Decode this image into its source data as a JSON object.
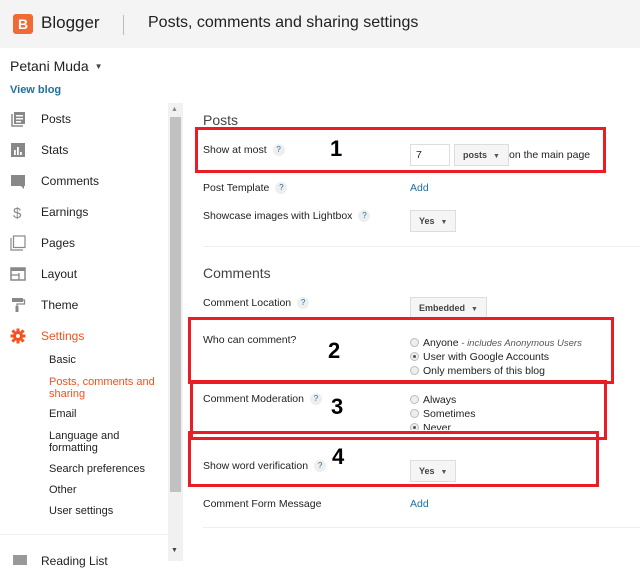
{
  "header": {
    "logo_letter": "B",
    "brand": "Blogger",
    "page_title": "Posts, comments and sharing settings"
  },
  "blog": {
    "name": "Petani Muda",
    "view_blog": "View blog"
  },
  "sidebar": {
    "items": [
      {
        "label": "Posts",
        "icon": "posts-icon"
      },
      {
        "label": "Stats",
        "icon": "stats-icon"
      },
      {
        "label": "Comments",
        "icon": "comments-icon"
      },
      {
        "label": "Earnings",
        "icon": "dollar-icon"
      },
      {
        "label": "Pages",
        "icon": "pages-icon"
      },
      {
        "label": "Layout",
        "icon": "layout-icon"
      },
      {
        "label": "Theme",
        "icon": "paint-roller-icon"
      },
      {
        "label": "Settings",
        "icon": "gear-icon",
        "active": true
      }
    ],
    "settings_sub": [
      {
        "label": "Basic"
      },
      {
        "label": "Posts, comments and sharing",
        "active": true
      },
      {
        "label": "Email"
      },
      {
        "label": "Language and formatting"
      },
      {
        "label": "Search preferences"
      },
      {
        "label": "Other"
      },
      {
        "label": "User settings"
      }
    ],
    "reading_list": "Reading List"
  },
  "accent_color": "#f4511e",
  "annotation_color": "#ec1c24",
  "posts_section": {
    "title": "Posts",
    "show_at_most": {
      "label": "Show at most",
      "value": "7",
      "unit": "posts",
      "suffix": "on the main page"
    },
    "post_template": {
      "label": "Post Template",
      "action": "Add"
    },
    "lightbox": {
      "label": "Showcase images with Lightbox",
      "value": "Yes"
    }
  },
  "comments_section": {
    "title": "Comments",
    "location": {
      "label": "Comment Location",
      "value": "Embedded"
    },
    "who_can_comment": {
      "label": "Who can comment?",
      "options": [
        {
          "label": "Anyone",
          "note": " - includes Anonymous Users",
          "checked": false
        },
        {
          "label": "User with Google Accounts",
          "note": "",
          "checked": true
        },
        {
          "label": "Only members of this blog",
          "note": "",
          "checked": false
        }
      ]
    },
    "moderation": {
      "label": "Comment Moderation",
      "options": [
        {
          "label": "Always",
          "checked": false
        },
        {
          "label": "Sometimes",
          "checked": false
        },
        {
          "label": "Never",
          "checked": true
        }
      ]
    },
    "word_verification": {
      "label": "Show word verification",
      "value": "Yes"
    },
    "form_message": {
      "label": "Comment Form Message",
      "action": "Add"
    }
  },
  "help_glyph": "?",
  "annotations": [
    "1",
    "2",
    "3",
    "4"
  ],
  "glyphs": {
    "caret": "▼",
    "scroll_up": "▲",
    "scroll_down": "▼"
  }
}
